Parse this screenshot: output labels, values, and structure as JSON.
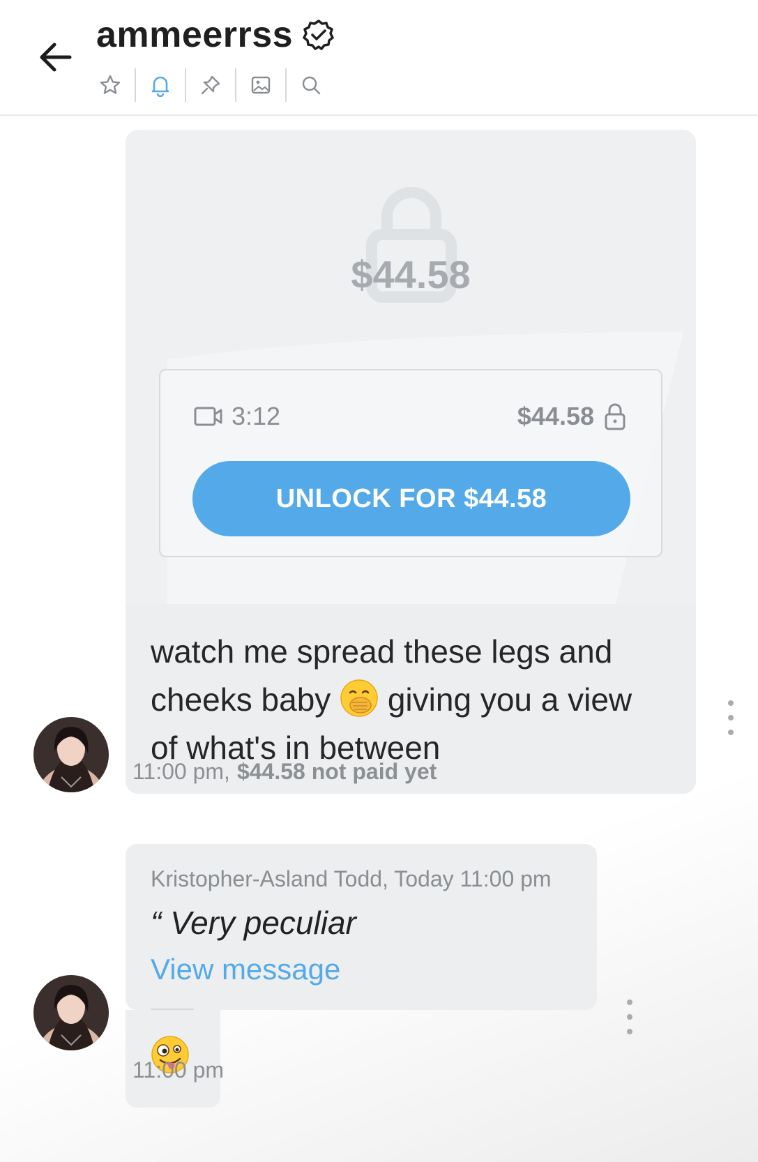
{
  "header": {
    "title": "ammeerrss",
    "toolbar_icons": [
      "star-icon",
      "bell-icon",
      "pin-icon",
      "image-icon",
      "search-icon"
    ],
    "active_tool": "bell-icon",
    "accent_color": "#54aae8"
  },
  "ppv_message": {
    "locked_price": "$44.58",
    "duration": "3:12",
    "price": "$44.58",
    "unlock_button": "UNLOCK FOR $44.58",
    "text_line1": "watch me spread these legs and",
    "text_line2a": "cheeks baby",
    "emoji1": "face-with-hand-over-mouth",
    "text_line2b": "giving you a view",
    "text_line3": "of what's in between",
    "time": "11:00 pm,",
    "status": "$44.58 not paid yet"
  },
  "reply_message": {
    "author_time": "Kristopher-Asland Todd, Today 11:00 pm",
    "quote": "“ Very peculiar",
    "link": "View message",
    "emoji": "zany-face",
    "time": "11:00 pm"
  }
}
